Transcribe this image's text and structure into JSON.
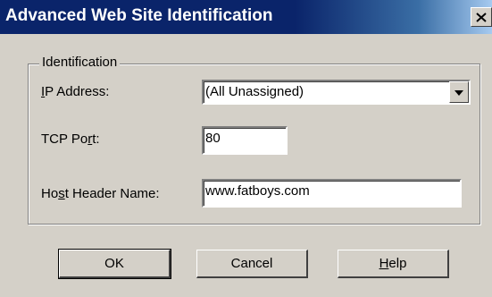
{
  "window": {
    "title": "Advanced Web Site Identification"
  },
  "group": {
    "legend": "Identification"
  },
  "fields": {
    "ip_address": {
      "label_prefix": "",
      "label_accel": "I",
      "label_rest": "P Address:",
      "value": "(All Unassigned)"
    },
    "tcp_port": {
      "label_prefix": "TCP Po",
      "label_accel": "r",
      "label_rest": "t:",
      "value": "80"
    },
    "host_header": {
      "label_prefix": "Ho",
      "label_accel": "s",
      "label_rest": "t Header Name:",
      "value": "www.fatboys.com"
    }
  },
  "buttons": {
    "ok": "OK",
    "cancel": "Cancel",
    "help_accel": "H",
    "help_rest": "elp"
  },
  "icons": {
    "close": "close-icon",
    "dropdown": "chevron-down-icon"
  }
}
